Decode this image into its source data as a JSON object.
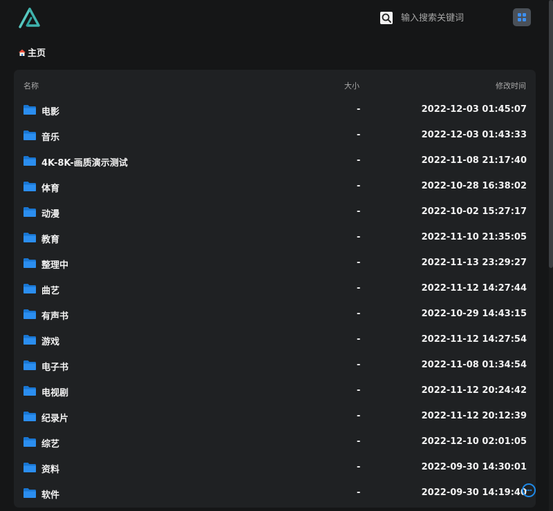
{
  "app": {
    "logo": "alist-logo",
    "accent_color": "#1e88e5"
  },
  "search": {
    "icon": "search-icon",
    "placeholder": "输入搜索关键词",
    "value": ""
  },
  "toolbar": {
    "apps_icon": "grid-icon"
  },
  "breadcrumb": {
    "icon": "home-icon",
    "label": "主页"
  },
  "table": {
    "headers": {
      "name": "名称",
      "size": "大小",
      "modified": "修改时间"
    },
    "rows": [
      {
        "name": "电影",
        "size": "-",
        "modified": "2022-12-03 01:45:07"
      },
      {
        "name": "音乐",
        "size": "-",
        "modified": "2022-12-03 01:43:33"
      },
      {
        "name": "4K-8K-画质演示测试",
        "size": "-",
        "modified": "2022-11-08 21:17:40"
      },
      {
        "name": "体育",
        "size": "-",
        "modified": "2022-10-28 16:38:02"
      },
      {
        "name": "动漫",
        "size": "-",
        "modified": "2022-10-02 15:27:17"
      },
      {
        "name": "教育",
        "size": "-",
        "modified": "2022-11-10 21:35:05"
      },
      {
        "name": "整理中",
        "size": "-",
        "modified": "2022-11-13 23:29:27"
      },
      {
        "name": "曲艺",
        "size": "-",
        "modified": "2022-11-12 14:27:44"
      },
      {
        "name": "有声书",
        "size": "-",
        "modified": "2022-10-29 14:43:15"
      },
      {
        "name": "游戏",
        "size": "-",
        "modified": "2022-11-12 14:27:54"
      },
      {
        "name": "电子书",
        "size": "-",
        "modified": "2022-11-08 01:34:54"
      },
      {
        "name": "电视剧",
        "size": "-",
        "modified": "2022-11-12 20:24:42"
      },
      {
        "name": "纪录片",
        "size": "-",
        "modified": "2022-11-12 20:12:39"
      },
      {
        "name": "综艺",
        "size": "-",
        "modified": "2022-12-10 02:01:05"
      },
      {
        "name": "资料",
        "size": "-",
        "modified": "2022-09-30 14:30:01"
      },
      {
        "name": "软件",
        "size": "-",
        "modified": "2022-09-30 14:19:40"
      }
    ]
  },
  "floating": {
    "icon": "chat-icon"
  }
}
